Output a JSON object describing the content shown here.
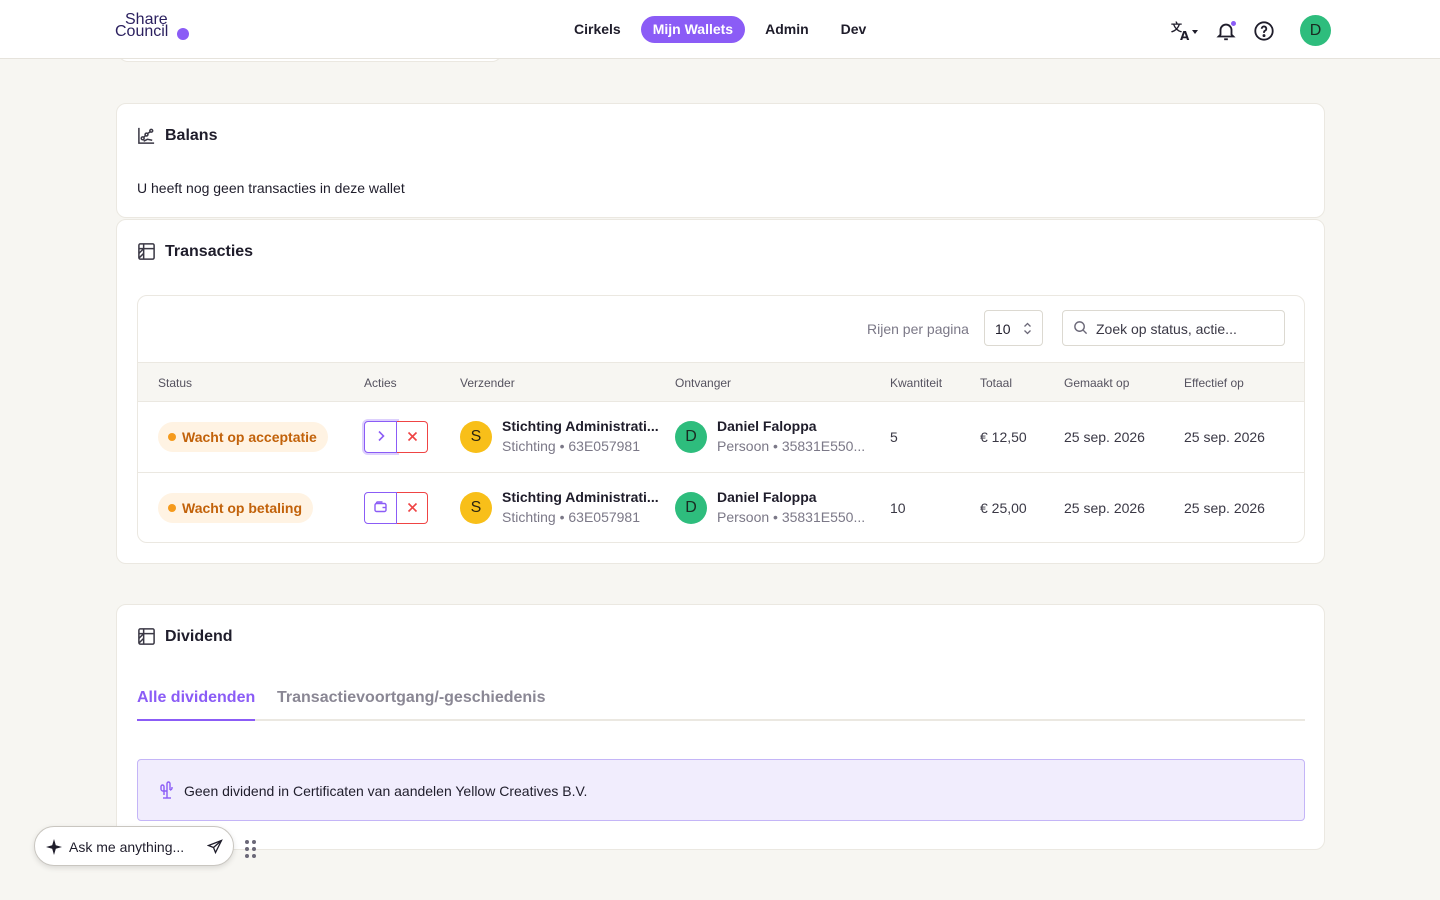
{
  "header": {
    "logo_line1": "Share",
    "logo_line2": "Council",
    "nav": [
      "Cirkels",
      "Mijn Wallets",
      "Admin",
      "Dev"
    ],
    "active_nav": "Mijn Wallets",
    "avatar_initial": "D",
    "icons": [
      "translate-icon",
      "bell-icon",
      "help-icon"
    ]
  },
  "balans": {
    "title": "Balans",
    "empty_text": "U heeft nog geen transacties in deze wallet"
  },
  "transacties": {
    "title": "Transacties",
    "rows_per_page_label": "Rijen per pagina",
    "rows_per_page_value": "10",
    "search_placeholder": "Zoek op status, actie...",
    "columns": [
      "Status",
      "Acties",
      "Verzender",
      "Ontvanger",
      "Kwantiteit",
      "Totaal",
      "Gemaakt op",
      "Effectief op"
    ],
    "rows": [
      {
        "status": "Wacht op acceptatie",
        "sender_initial": "S",
        "sender_name": "Stichting Administrati...",
        "sender_sub": "Stichting • 63E057981",
        "receiver_initial": "D",
        "receiver_name": "Daniel Faloppa",
        "receiver_sub": "Persoon • 35831E550...",
        "quantity": "5",
        "total": "€ 12,50",
        "created": "25 sep. 2026",
        "effective": "25 sep. 2026"
      },
      {
        "status": "Wacht op betaling",
        "sender_initial": "S",
        "sender_name": "Stichting Administrati...",
        "sender_sub": "Stichting • 63E057981",
        "receiver_initial": "D",
        "receiver_name": "Daniel Faloppa",
        "receiver_sub": "Persoon • 35831E550...",
        "quantity": "10",
        "total": "€ 25,00",
        "created": "25 sep. 2026",
        "effective": "25 sep. 2026"
      }
    ]
  },
  "dividend": {
    "title": "Dividend",
    "tabs": [
      "Alle dividenden",
      "Transactievoortgang/-geschiedenis"
    ],
    "active_tab": "Alle dividenden",
    "empty_text": "Geen dividend in Certificaten van aandelen Yellow Creatives B.V."
  },
  "assistant": {
    "placeholder": "Ask me anything..."
  },
  "colors": {
    "accent": "#8b5cf6",
    "status_orange": "#c2620a",
    "danger": "#ef4444",
    "avatar_green": "#2ebd7d",
    "avatar_yellow": "#f8bf19"
  }
}
